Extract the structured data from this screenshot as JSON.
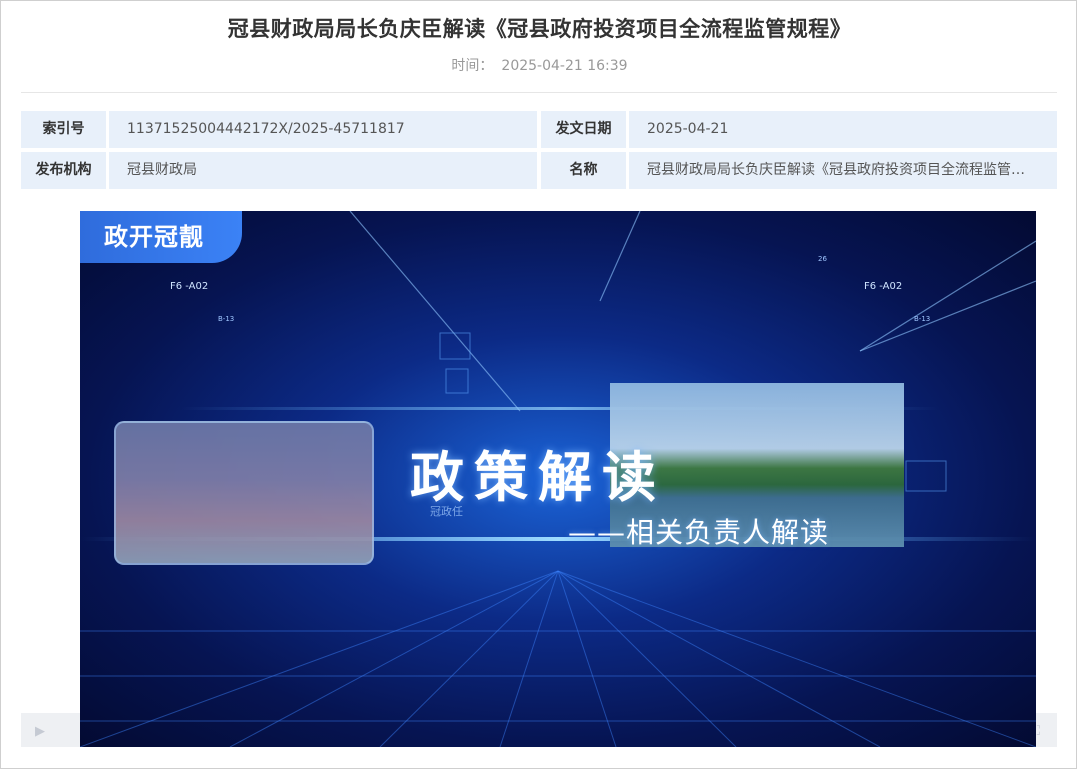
{
  "article": {
    "title": "冠县财政局局长负庆臣解读《冠县政府投资项目全流程监管规程》",
    "time_label": "时间：",
    "time_value": "2025-04-21 16:39"
  },
  "meta": {
    "index_label": "索引号",
    "index_value": "11371525004442172X/2025-45711817",
    "date_label": "发文日期",
    "date_value": "2025-04-21",
    "org_label": "发布机构",
    "org_value": "冠县财政局",
    "name_label": "名称",
    "name_value": "冠县财政局局长负庆臣解读《冠县政府投资项目全流程监管…"
  },
  "video": {
    "brand_tag": "政开冠靓",
    "banner_title": "政策解读",
    "banner_subtitle": "——相关负责人解读",
    "hud_left": "F6 -A02",
    "hud_right": "F6 -A02",
    "hud_b13_left": "B-13",
    "hud_b13_right": "B-13",
    "hud_26": "26",
    "hud_watermark": "冠政任"
  },
  "colors": {
    "meta_bg": "#e8f0fa",
    "video_bg": "#0c2a86",
    "brand_tag_bg": "#2f6cdc"
  }
}
